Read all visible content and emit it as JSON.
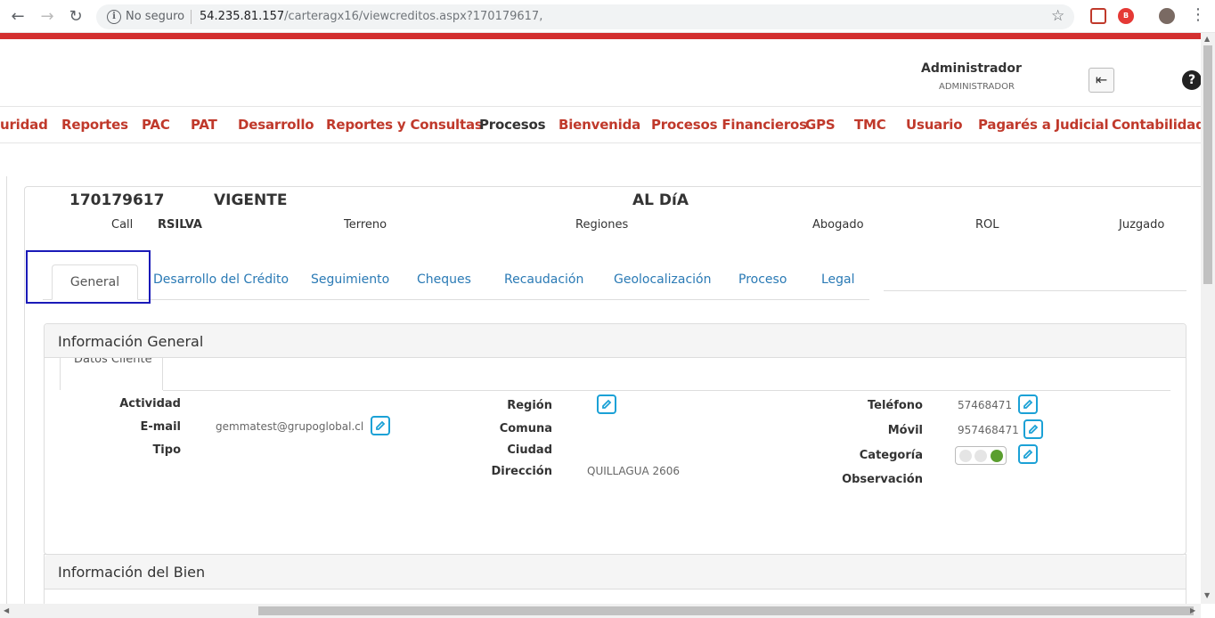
{
  "browser": {
    "security_label": "No seguro",
    "url_host": "54.235.81.157",
    "url_path": "/carteragx16/viewcreditos.aspx?170179617,"
  },
  "header": {
    "user_name": "Administrador",
    "user_role": "ADMINISTRADOR",
    "help_label": "?"
  },
  "nav": {
    "items": [
      "uridad",
      "Reportes",
      "PAC",
      "PAT",
      "Desarrollo",
      "Reportes y Consultas",
      "Procesos",
      "Bienvenida",
      "Procesos Financieros",
      "GPS",
      "TMC",
      "Usuario",
      "Pagarés a Judicial",
      "Contabilidad"
    ]
  },
  "credit": {
    "number": "170179617",
    "state": "VIGENTE",
    "status": "AL DíA",
    "call_label": "Call",
    "call_value": "RSILVA",
    "terreno_label": "Terreno",
    "regiones_label": "Regiones",
    "abogado_label": "Abogado",
    "rol_label": "ROL",
    "juzgado_label": "Juzgado"
  },
  "tabs": [
    "General",
    "Desarrollo del Crédito",
    "Seguimiento",
    "Cheques",
    "Recaudación",
    "Geolocalización",
    "Proceso",
    "Legal"
  ],
  "info_general": {
    "title": "Información General",
    "subtab": "Datos Cliente",
    "fields": {
      "actividad": {
        "label": "Actividad",
        "value": ""
      },
      "email": {
        "label": "E-mail",
        "value": "gemmatest@grupoglobal.cl"
      },
      "tipo": {
        "label": "Tipo",
        "value": ""
      },
      "region": {
        "label": "Región",
        "value": ""
      },
      "comuna": {
        "label": "Comuna",
        "value": ""
      },
      "ciudad": {
        "label": "Ciudad",
        "value": ""
      },
      "direccion": {
        "label": "Dirección",
        "value": "QUILLAGUA 2606"
      },
      "telefono": {
        "label": "Teléfono",
        "value": "57468471"
      },
      "movil": {
        "label": "Móvil",
        "value": "957468471"
      },
      "categoria": {
        "label": "Categoría",
        "value": ""
      },
      "observacion": {
        "label": "Observación",
        "value": ""
      }
    }
  },
  "info_bien": {
    "title": "Información del Bien"
  },
  "colors": {
    "brand_red": "#c0392b",
    "link_blue": "#2a7ab5",
    "edit_blue": "#1ba1d6",
    "toggle_green": "#5a9e2f"
  }
}
